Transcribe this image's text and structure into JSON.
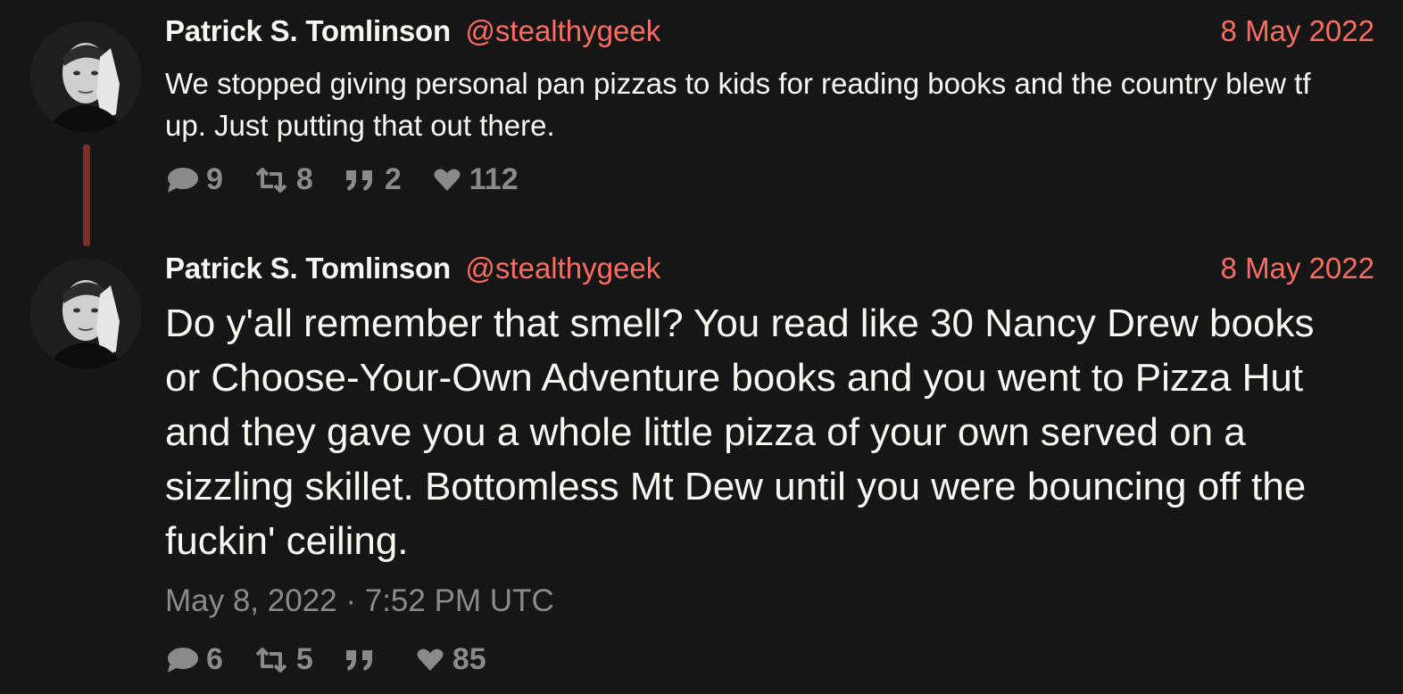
{
  "thread": [
    {
      "fullname": "Patrick S. Tomlinson",
      "username": "@stealthygeek",
      "date": "8 May 2022",
      "text": "We stopped giving personal pan pizzas to kids for reading books and the country blew tf up. Just putting that out there.",
      "stats": {
        "replies": "9",
        "retweets": "8",
        "quotes": "2",
        "likes": "112"
      }
    },
    {
      "fullname": "Patrick S. Tomlinson",
      "username": "@stealthygeek",
      "date": "8 May 2022",
      "text": "Do y'all remember that smell? You read like 30 Nancy Drew books or Choose-Your-Own Adventure books and you went to Pizza Hut and they gave you a whole little pizza of your own served on a sizzling skillet. Bottomless Mt Dew until you were bouncing off the fuckin' ceiling.",
      "published": "May 8, 2022 · 7:52 PM UTC",
      "stats": {
        "replies": "6",
        "retweets": "5",
        "quotes": "",
        "likes": "85"
      }
    }
  ],
  "colors": {
    "background": "#161616",
    "text": "#f8f8f2",
    "accent": "#ff6c60",
    "muted": "#8a8a8a",
    "thread_line": "#7a2f2a"
  },
  "icons": {
    "reply": "comment-icon",
    "retweet": "retweet-icon",
    "quote": "quote-icon",
    "like": "heart-icon"
  }
}
